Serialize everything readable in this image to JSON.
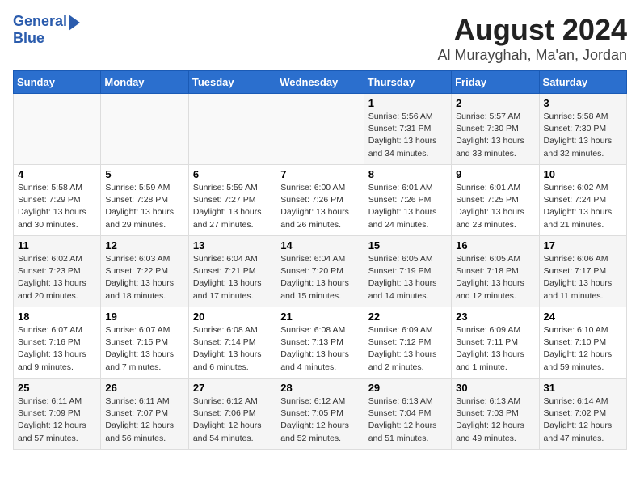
{
  "header": {
    "logo_line1": "General",
    "logo_line2": "Blue",
    "title": "August 2024",
    "subtitle": "Al Murayghah, Ma'an, Jordan"
  },
  "weekdays": [
    "Sunday",
    "Monday",
    "Tuesday",
    "Wednesday",
    "Thursday",
    "Friday",
    "Saturday"
  ],
  "weeks": [
    [
      {
        "day": "",
        "detail": ""
      },
      {
        "day": "",
        "detail": ""
      },
      {
        "day": "",
        "detail": ""
      },
      {
        "day": "",
        "detail": ""
      },
      {
        "day": "1",
        "detail": "Sunrise: 5:56 AM\nSunset: 7:31 PM\nDaylight: 13 hours\nand 34 minutes."
      },
      {
        "day": "2",
        "detail": "Sunrise: 5:57 AM\nSunset: 7:30 PM\nDaylight: 13 hours\nand 33 minutes."
      },
      {
        "day": "3",
        "detail": "Sunrise: 5:58 AM\nSunset: 7:30 PM\nDaylight: 13 hours\nand 32 minutes."
      }
    ],
    [
      {
        "day": "4",
        "detail": "Sunrise: 5:58 AM\nSunset: 7:29 PM\nDaylight: 13 hours\nand 30 minutes."
      },
      {
        "day": "5",
        "detail": "Sunrise: 5:59 AM\nSunset: 7:28 PM\nDaylight: 13 hours\nand 29 minutes."
      },
      {
        "day": "6",
        "detail": "Sunrise: 5:59 AM\nSunset: 7:27 PM\nDaylight: 13 hours\nand 27 minutes."
      },
      {
        "day": "7",
        "detail": "Sunrise: 6:00 AM\nSunset: 7:26 PM\nDaylight: 13 hours\nand 26 minutes."
      },
      {
        "day": "8",
        "detail": "Sunrise: 6:01 AM\nSunset: 7:26 PM\nDaylight: 13 hours\nand 24 minutes."
      },
      {
        "day": "9",
        "detail": "Sunrise: 6:01 AM\nSunset: 7:25 PM\nDaylight: 13 hours\nand 23 minutes."
      },
      {
        "day": "10",
        "detail": "Sunrise: 6:02 AM\nSunset: 7:24 PM\nDaylight: 13 hours\nand 21 minutes."
      }
    ],
    [
      {
        "day": "11",
        "detail": "Sunrise: 6:02 AM\nSunset: 7:23 PM\nDaylight: 13 hours\nand 20 minutes."
      },
      {
        "day": "12",
        "detail": "Sunrise: 6:03 AM\nSunset: 7:22 PM\nDaylight: 13 hours\nand 18 minutes."
      },
      {
        "day": "13",
        "detail": "Sunrise: 6:04 AM\nSunset: 7:21 PM\nDaylight: 13 hours\nand 17 minutes."
      },
      {
        "day": "14",
        "detail": "Sunrise: 6:04 AM\nSunset: 7:20 PM\nDaylight: 13 hours\nand 15 minutes."
      },
      {
        "day": "15",
        "detail": "Sunrise: 6:05 AM\nSunset: 7:19 PM\nDaylight: 13 hours\nand 14 minutes."
      },
      {
        "day": "16",
        "detail": "Sunrise: 6:05 AM\nSunset: 7:18 PM\nDaylight: 13 hours\nand 12 minutes."
      },
      {
        "day": "17",
        "detail": "Sunrise: 6:06 AM\nSunset: 7:17 PM\nDaylight: 13 hours\nand 11 minutes."
      }
    ],
    [
      {
        "day": "18",
        "detail": "Sunrise: 6:07 AM\nSunset: 7:16 PM\nDaylight: 13 hours\nand 9 minutes."
      },
      {
        "day": "19",
        "detail": "Sunrise: 6:07 AM\nSunset: 7:15 PM\nDaylight: 13 hours\nand 7 minutes."
      },
      {
        "day": "20",
        "detail": "Sunrise: 6:08 AM\nSunset: 7:14 PM\nDaylight: 13 hours\nand 6 minutes."
      },
      {
        "day": "21",
        "detail": "Sunrise: 6:08 AM\nSunset: 7:13 PM\nDaylight: 13 hours\nand 4 minutes."
      },
      {
        "day": "22",
        "detail": "Sunrise: 6:09 AM\nSunset: 7:12 PM\nDaylight: 13 hours\nand 2 minutes."
      },
      {
        "day": "23",
        "detail": "Sunrise: 6:09 AM\nSunset: 7:11 PM\nDaylight: 13 hours\nand 1 minute."
      },
      {
        "day": "24",
        "detail": "Sunrise: 6:10 AM\nSunset: 7:10 PM\nDaylight: 12 hours\nand 59 minutes."
      }
    ],
    [
      {
        "day": "25",
        "detail": "Sunrise: 6:11 AM\nSunset: 7:09 PM\nDaylight: 12 hours\nand 57 minutes."
      },
      {
        "day": "26",
        "detail": "Sunrise: 6:11 AM\nSunset: 7:07 PM\nDaylight: 12 hours\nand 56 minutes."
      },
      {
        "day": "27",
        "detail": "Sunrise: 6:12 AM\nSunset: 7:06 PM\nDaylight: 12 hours\nand 54 minutes."
      },
      {
        "day": "28",
        "detail": "Sunrise: 6:12 AM\nSunset: 7:05 PM\nDaylight: 12 hours\nand 52 minutes."
      },
      {
        "day": "29",
        "detail": "Sunrise: 6:13 AM\nSunset: 7:04 PM\nDaylight: 12 hours\nand 51 minutes."
      },
      {
        "day": "30",
        "detail": "Sunrise: 6:13 AM\nSunset: 7:03 PM\nDaylight: 12 hours\nand 49 minutes."
      },
      {
        "day": "31",
        "detail": "Sunrise: 6:14 AM\nSunset: 7:02 PM\nDaylight: 12 hours\nand 47 minutes."
      }
    ]
  ]
}
